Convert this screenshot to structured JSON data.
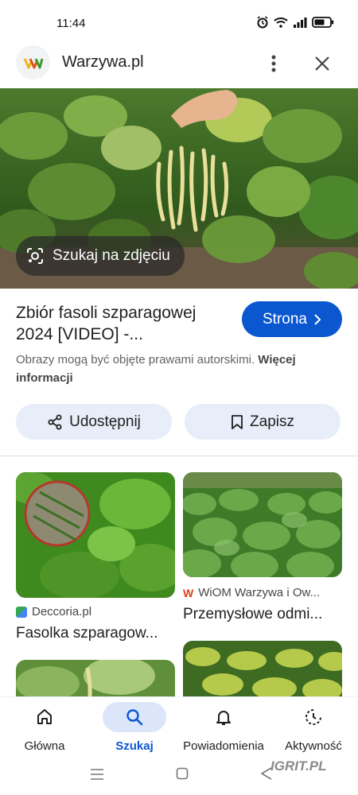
{
  "status_bar": {
    "time": "11:44",
    "icons": [
      "alarm-icon",
      "wifi-icon",
      "signal-icon",
      "battery-icon"
    ]
  },
  "header": {
    "site_name": "Warzywa.pl",
    "logo_icon": "warzywa-logo-icon",
    "more_icon": "more-vert-icon",
    "close_icon": "close-icon"
  },
  "hero": {
    "lens_chip_label": "Szukaj na zdjęciu",
    "lens_icon": "lens-icon"
  },
  "detail": {
    "title": "Zbiór fasoli szparagowej 2024 [VIDEO] -...",
    "visit_label": "Strona",
    "copyright_text": "Obrazy mogą być objęte prawami autorskimi.",
    "copyright_link": "Więcej informacji"
  },
  "actions": {
    "share_label": "Udostępnij",
    "save_label": "Zapisz"
  },
  "results": [
    {
      "source": "Deccoria.pl",
      "title": "Fasolka szparagow..."
    },
    {
      "source": "WiOM Warzywa i Ow...",
      "title": "Przemysłowe odmi..."
    }
  ],
  "bottom_nav": [
    {
      "label": "Główna",
      "icon": "home-icon",
      "active": false
    },
    {
      "label": "Szukaj",
      "icon": "search-icon",
      "active": true
    },
    {
      "label": "Powiadomienia",
      "icon": "bell-icon",
      "active": false
    },
    {
      "label": "Aktywność",
      "icon": "activity-icon",
      "active": false
    }
  ],
  "watermark": "IGRIT.PL",
  "colors": {
    "accent": "#0b57d0",
    "action_bg": "#e8eef9",
    "active_nav_bg": "#dbe6fb",
    "secondary_text": "#5f6368"
  }
}
